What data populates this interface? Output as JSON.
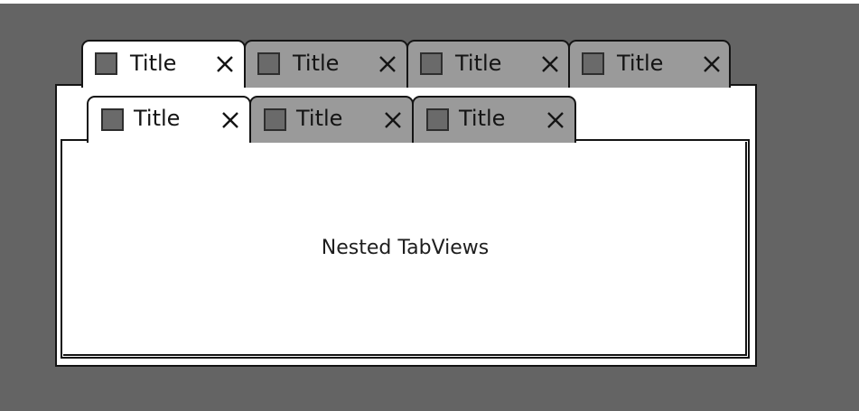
{
  "outer_tabview": {
    "tabs": [
      {
        "label": "Title",
        "icon": "square-icon",
        "close": "close-icon",
        "active": true
      },
      {
        "label": "Title",
        "icon": "square-icon",
        "close": "close-icon",
        "active": false
      },
      {
        "label": "Title",
        "icon": "square-icon",
        "close": "close-icon",
        "active": false
      },
      {
        "label": "Title",
        "icon": "square-icon",
        "close": "close-icon",
        "active": false
      }
    ]
  },
  "inner_tabview": {
    "tabs": [
      {
        "label": "Title",
        "icon": "square-icon",
        "close": "close-icon",
        "active": true
      },
      {
        "label": "Title",
        "icon": "square-icon",
        "close": "close-icon",
        "active": false
      },
      {
        "label": "Title",
        "icon": "square-icon",
        "close": "close-icon",
        "active": false
      }
    ],
    "content_text": "Nested TabViews"
  },
  "colors": {
    "background": "#646464",
    "active_tab": "#ffffff",
    "inactive_tab": "#9a9a9a",
    "border": "#141414"
  }
}
